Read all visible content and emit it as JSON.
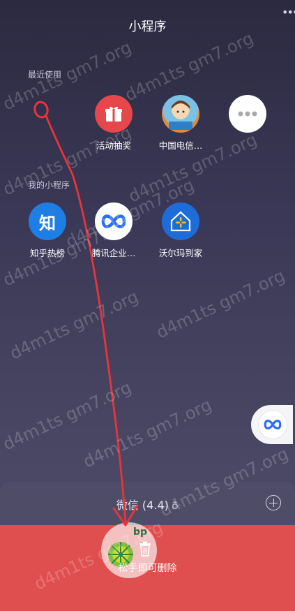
{
  "header": {
    "title": "小程序",
    "menu_icon": "more-dots-icon"
  },
  "recent": {
    "label": "最近使用",
    "items": [
      {
        "label": "活动抽奖",
        "icon": "gift-icon"
      },
      {
        "label": "中国电信…",
        "icon": "telecom-avatar-icon"
      },
      {
        "label": "",
        "icon": "more-icon"
      }
    ]
  },
  "mine": {
    "label": "我的小程序",
    "items": [
      {
        "label": "知乎热榜",
        "icon": "zhihu-icon",
        "glyph": "知"
      },
      {
        "label": "腾讯企业…",
        "icon": "tencent-meeting-icon"
      },
      {
        "label": "沃尔玛到家",
        "icon": "walmart-house-icon"
      }
    ]
  },
  "wechat_bar": {
    "title": "微信 (4.4)",
    "add_icon": "plus-circle-icon"
  },
  "delete_zone": {
    "label": "松手即可删除",
    "drag_item_text": "bp"
  },
  "watermark_text": "d4m1ts gm7.org",
  "colors": {
    "delete": "#e04f4f",
    "zhihu": "#1e7ee4",
    "gift": "#e6474b",
    "arrow": "#e8343a"
  }
}
